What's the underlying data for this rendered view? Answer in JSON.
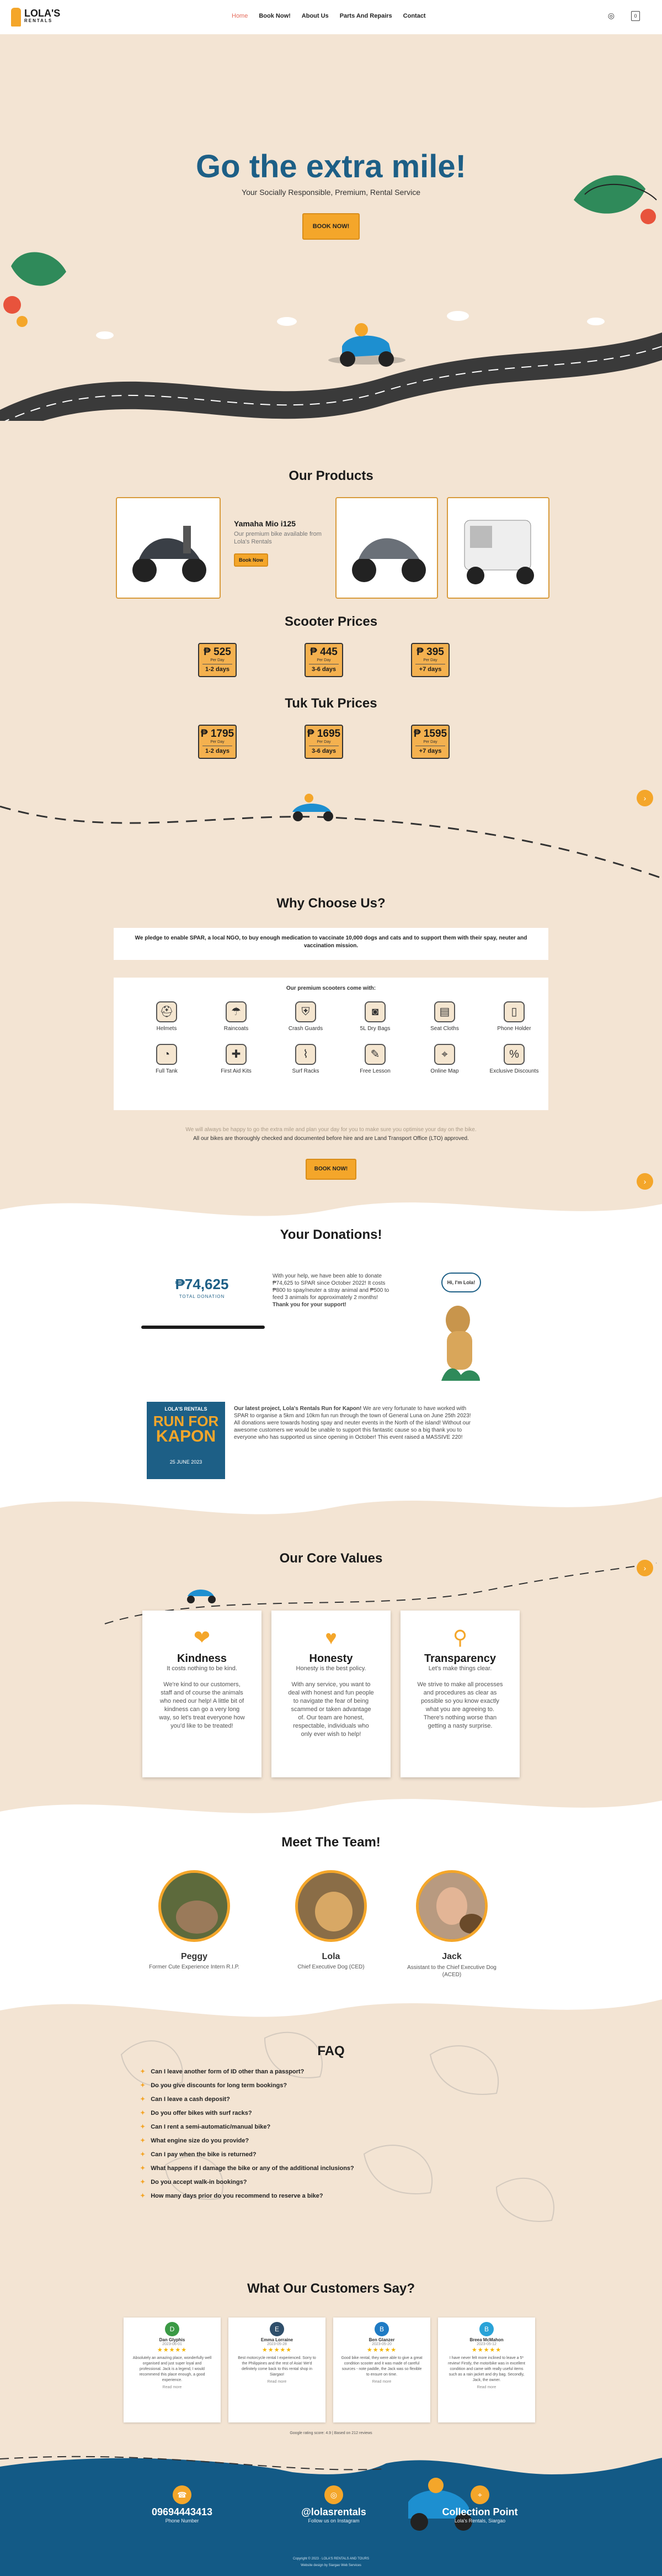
{
  "header": {
    "logo_text": "LOLA'S",
    "logo_sub": "RENTALS",
    "nav": [
      "Home",
      "Book Now!",
      "About Us",
      "Parts And Repairs",
      "Contact"
    ],
    "cart_count": "0"
  },
  "hero": {
    "title": "Go the extra mile!",
    "subtitle": "Your Socially Responsible, Premium, Rental Service",
    "button": "BOOK NOW!"
  },
  "products": {
    "title": "Our Products",
    "item_name": "Yamaha Mio i125",
    "item_desc": "Our premium bike available from Lola's Rentals",
    "item_btn": "Book Now"
  },
  "scooter_prices": {
    "title": "Scooter Prices",
    "items": [
      {
        "amount": "₱ 525",
        "per": "Per Day",
        "days": "1-2 days"
      },
      {
        "amount": "₱ 445",
        "per": "Per Day",
        "days": "3-6 days"
      },
      {
        "amount": "₱ 395",
        "per": "Per Day",
        "days": "+7 days"
      }
    ]
  },
  "tuktuk_prices": {
    "title": "Tuk Tuk Prices",
    "items": [
      {
        "amount": "₱ 1795",
        "per": "Per Day",
        "days": "1-2 days"
      },
      {
        "amount": "₱ 1695",
        "per": "Per Day",
        "days": "3-6 days"
      },
      {
        "amount": "₱ 1595",
        "per": "Per Day",
        "days": "+7 days"
      }
    ]
  },
  "why": {
    "title": "Why Choose Us?",
    "pledge": "We pledge to enable SPAR, a local NGO, to buy enough medication to vaccinate 10,000 dogs and cats and to support them with their spay, neuter and vaccination mission.",
    "features_title": "Our premium scooters come with:",
    "features": [
      "Helmets",
      "Raincoats",
      "Crash Guards",
      "5L Dry Bags",
      "Seat Cloths",
      "Phone Holder",
      "Full Tank",
      "First Aid Kits",
      "Surf Racks",
      "Free Lesson",
      "Online Map",
      "Exclusive Discounts"
    ],
    "feature_icons": [
      "helmet",
      "raincoat",
      "shield",
      "bag",
      "seat",
      "phone",
      "gauge",
      "first-aid",
      "surf",
      "lesson",
      "map",
      "discount"
    ],
    "note1": "We will always be happy to go the extra mile and plan your day for you to make sure you optimise your day on the bike.",
    "note2": "All our bikes are thoroughly checked and documented before hire and are Land Transport Office (LTO) approved.",
    "button": "BOOK NOW!"
  },
  "donations": {
    "title": "Your Donations!",
    "amount": "₱74,625",
    "label": "TOTAL DONATION",
    "text": "With your help, we have been able to donate ₱74,625 to SPAR since October 2022! It costs ₱800 to spay/neuter a stray animal and ₱500 to feed 3 animals for approximately 2 months!",
    "thanks": "Thank you for your support!",
    "bubble": "Hi, I'm Lola!",
    "poster_line1": "LOLA'S RENTALS",
    "poster_line2": "RUN FOR",
    "poster_line3": "KAPON",
    "poster_date": "25 JUNE 2023",
    "project_lead": "Our latest project, Lola's Rentals Run for Kapon!",
    "project_text": "We are very fortunate to have worked with SPAR to organise a 5km and 10km fun run through the town of General Luna on June 25th 2023! All donations were towards hosting spay and neuter events in the North of the island! Without our awesome customers we would be unable to support this fantastic cause so a big thank you to everyone who has supported us since opening in October! This event raised a MASSIVE 220!"
  },
  "values": {
    "title": "Our Core Values",
    "items": [
      {
        "name": "Kindness",
        "sub": "It costs nothing to be kind.",
        "body": "We're kind to our customers, staff and of course the animals who need our help! A little bit of kindness can go a very long way, so let's treat everyone how you'd like to be treated!"
      },
      {
        "name": "Honesty",
        "sub": "Honesty is the best policy.",
        "body": "With any service, you want to deal with honest and fun people to navigate the fear of being scammed or taken advantage of. Our team are honest, respectable, individuals who only ever wish to help!"
      },
      {
        "name": "Transparency",
        "sub": "Let's make things clear.",
        "body": "We strive to make all processes and procedures as clear as possible so you know exactly what you are agreeing to. There's nothing worse than getting a nasty surprise."
      }
    ]
  },
  "team": {
    "title": "Meet The Team!",
    "members": [
      {
        "name": "Peggy",
        "role": "Former Cute Experience Intern R.I.P."
      },
      {
        "name": "Lola",
        "role": "Chief Executive Dog (CED)"
      },
      {
        "name": "Jack",
        "role": "Assistant to the Chief Executive Dog (ACED)"
      }
    ]
  },
  "faq": {
    "title": "FAQ",
    "items": [
      "Can I leave another form of ID other than a passport?",
      "Do you give discounts for long term bookings?",
      "Can I leave a cash deposit?",
      "Do you offer bikes with surf racks?",
      "Can I rent a semi-automatic/manual bike?",
      "What engine size do you provide?",
      "Can I pay when the bike is returned?",
      "What happens if I damage the bike or any of the additional inclusions?",
      "Do you accept walk-in bookings?",
      "How many days prior do you recommend to reserve a bike?"
    ]
  },
  "reviews": {
    "title": "What Our Customers Say?",
    "items": [
      {
        "initial": "D",
        "name": "Dan Glyphis",
        "date": "2023-06-01",
        "stars": "★★★★★",
        "text": "Absolutely an amazing place, wonderfully well organised and just super loyal and professional. Jack is a legend, I would recommend this place enough, a good experience.",
        "more": "Read more",
        "color": "#3b9a45"
      },
      {
        "initial": "E",
        "name": "Emma Lorraine",
        "date": "2023-05-28",
        "stars": "★★★★★",
        "text": "Best motorcycle rental I experienced. Sorry to the Philippines and the rest of Asia! We'd definitely come back to this rental shop in Siargao!",
        "more": "Read more",
        "color": "#2f4f6b"
      },
      {
        "initial": "B",
        "name": "Ben Glanzer",
        "date": "2023-05-20",
        "stars": "★★★★★",
        "text": "Good bike rental, they were able to give a great condition scooter and it was made of careful sources - note paddle, the Jack was so flexible to ensure on time.",
        "more": "Read more",
        "color": "#1f7bc4"
      },
      {
        "initial": "B",
        "name": "Breea McMahon",
        "date": "2023-05-12",
        "stars": "★★★★★",
        "text": "I have never felt more inclined to leave a 5* review! Firstly, the motorbike was in excellent condition and came with really useful items such as a rain jacket and dry bag. Secondly, Jack, the owner.",
        "more": "Read more",
        "color": "#2aa3d8"
      }
    ],
    "footer_note": "Google rating score: 4.9 | Based on 212 reviews"
  },
  "footer": {
    "phone": "09694443413",
    "phone_label": "Phone Number",
    "instagram": "@lolasrentals",
    "instagram_label": "Follow us on Instagram",
    "collection": "Collection Point",
    "collection_label": "Lola's Rentals, Siargao",
    "copyright": "Copyright © 2023 · LOLA'S RENTALS AND TOURS",
    "copyright2": "Website design by Siargao Web Services"
  },
  "colors": {
    "accent": "#f4a62a",
    "brand_blue": "#1d5f86",
    "footer_bg": "#135a86"
  }
}
